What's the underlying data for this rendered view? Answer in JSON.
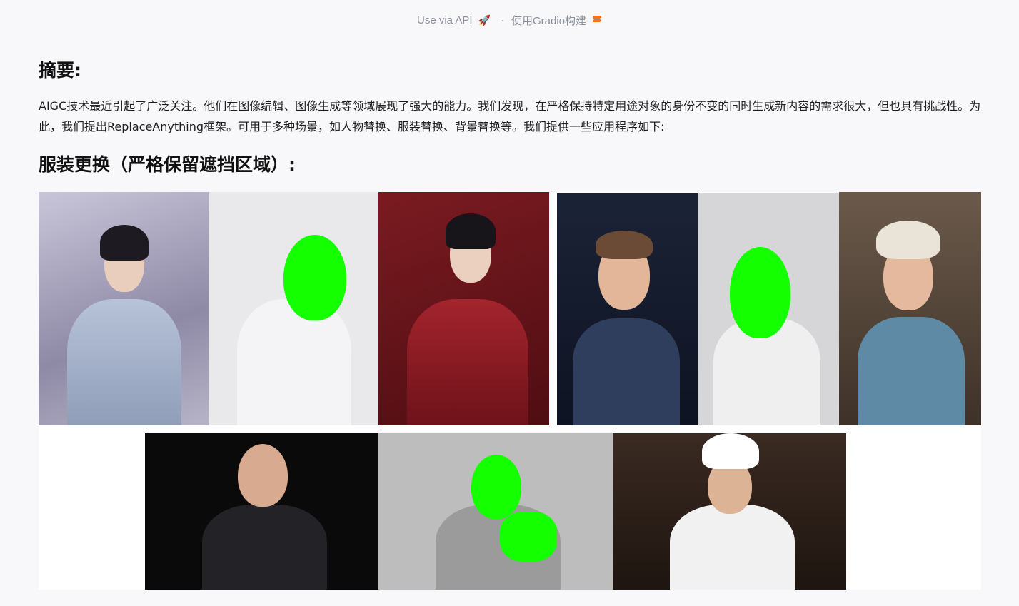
{
  "footer": {
    "api_label": "Use via API",
    "separator": "·",
    "built_with": "使用Gradio构建",
    "rocket_icon": "rocket-icon",
    "gradio_icon": "gradio-logo-icon"
  },
  "abstract": {
    "heading": "摘要:",
    "text": "AIGC技术最近引起了广泛关注。他们在图像编辑、图像生成等领域展现了强大的能力。我们发现，在严格保持特定用途对象的身份不变的同时生成新内容的需求很大，但也具有挑战性。为此，我们提出ReplaceAnything框架。可用于多种场景，如人物替换、服装替换、背景替换等。我们提供一些应用程序如下:"
  },
  "section": {
    "heading": "服装更换（严格保留遮挡区域）:"
  },
  "colors": {
    "mask": "#14ff00",
    "background": "#f8f8fb"
  }
}
